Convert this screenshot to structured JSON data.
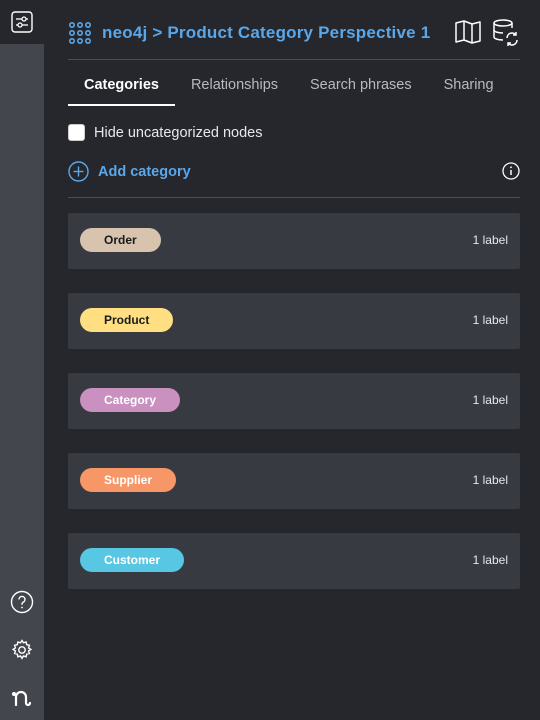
{
  "header": {
    "title": "neo4j > Product Category Perspective 1",
    "accent": "#5aa7ea"
  },
  "tabs": [
    {
      "label": "Categories",
      "active": true
    },
    {
      "label": "Relationships",
      "active": false
    },
    {
      "label": "Search phrases",
      "active": false
    },
    {
      "label": "Sharing",
      "active": false
    }
  ],
  "options": {
    "hide_uncategorized_label": "Hide uncategorized nodes",
    "hide_uncategorized_checked": false
  },
  "add_category": {
    "label": "Add category"
  },
  "categories": [
    {
      "name": "Order",
      "count": "1 label",
      "color": "#d8c3ae",
      "text_color": "#1a1a1a"
    },
    {
      "name": "Product",
      "count": "1 label",
      "color": "#ffdf81",
      "text_color": "#1a1a1a"
    },
    {
      "name": "Category",
      "count": "1 label",
      "color": "#c990c0",
      "text_color": "#ffffff"
    },
    {
      "name": "Supplier",
      "count": "1 label",
      "color": "#f79767",
      "text_color": "#ffffff"
    },
    {
      "name": "Customer",
      "count": "1 label",
      "color": "#57c7e3",
      "text_color": "#ffffff"
    }
  ],
  "rail_icons": [
    "sliders-icon",
    "help-icon",
    "settings-icon",
    "neo4j-logo-icon"
  ],
  "header_icons": [
    "book-icon",
    "database-refresh-icon"
  ]
}
